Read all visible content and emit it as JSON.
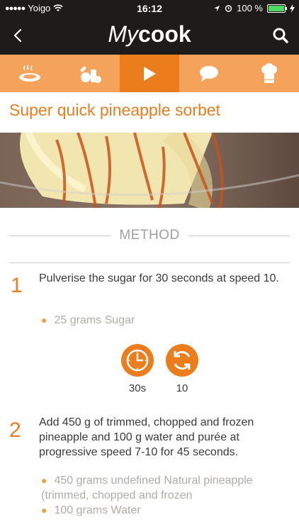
{
  "status": {
    "carrier": "Yoigo",
    "time": "16:12",
    "battery": "100 %"
  },
  "app": {
    "logo_my": "My",
    "logo_cook": "cook"
  },
  "tabs": [
    {
      "icon": "plate-icon"
    },
    {
      "icon": "ingredients-icon"
    },
    {
      "icon": "play-icon",
      "active": true
    },
    {
      "icon": "comment-icon"
    },
    {
      "icon": "chef-hat-icon"
    }
  ],
  "recipe": {
    "title": "Super quick pineapple sorbet"
  },
  "section": {
    "method_label": "METHOD"
  },
  "steps": [
    {
      "number": "1",
      "text": "Pulverise the sugar for 30 seconds at speed 10.",
      "ingredients": [
        "25 grams Sugar"
      ],
      "chips": [
        {
          "icon": "clock-icon",
          "value": "30s"
        },
        {
          "icon": "speed-icon",
          "value": "10"
        }
      ]
    },
    {
      "number": "2",
      "text": "Add 450 g of trimmed, chopped and frozen pineapple and 100 g water and purée at progressive speed 7-10 for 45 seconds.",
      "ingredients": [
        "450 grams undefined Natural pineapple (trimmed, chopped and frozen",
        "100 grams Water"
      ]
    }
  ],
  "colors": {
    "accent": "#ec7d1c",
    "tab_bar": "#f5a35a",
    "header": "#1e1c1a"
  }
}
